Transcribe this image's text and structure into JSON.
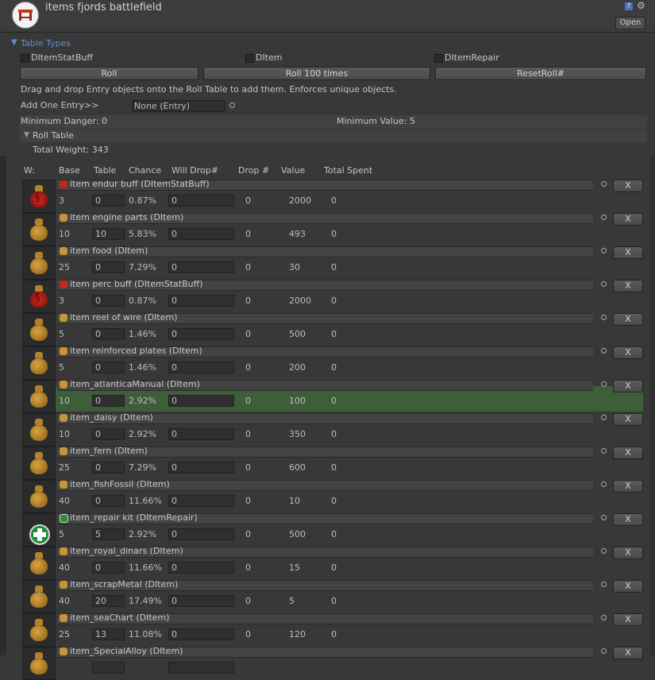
{
  "header": {
    "title": "items fjords battlefield",
    "open_label": "Open",
    "help_glyph": "?",
    "gear_glyph": "⚙"
  },
  "table_types": {
    "label": "Table Types",
    "checks": [
      "DItemStatBuff",
      "DItem",
      "DItemRepair"
    ],
    "buttons": [
      "Roll",
      "Roll 100 times",
      "ResetRoll#"
    ],
    "instructions": "Drag and drop Entry objects onto the Roll Table to add them. Enforces unique objects.",
    "add_entry_label": "Add One Entry>>",
    "add_entry_value": "None (Entry)",
    "min_danger": "Minimum Danger: 0",
    "min_value": "Minimum Value: 5",
    "roll_table_label": "Roll Table",
    "total_weight": "Total Weight: 343"
  },
  "columns": [
    "W:",
    "Base",
    "Table",
    "Chance",
    "Will Drop#",
    "Drop #",
    "Value",
    "Total Spent"
  ],
  "x_label": "X",
  "rows": [
    {
      "name": "item endur buff (DItemStatBuff)",
      "base": "3",
      "table": "0",
      "chance": "0.87%",
      "will": "0",
      "drop": "0",
      "value": "2000",
      "spent": "0",
      "icon": "buff-icon",
      "hl": false
    },
    {
      "name": "item engine parts (DItem)",
      "base": "10",
      "table": "10",
      "chance": "5.83%",
      "will": "0",
      "drop": "0",
      "value": "493",
      "spent": "0",
      "icon": "bag-icon",
      "hl": false
    },
    {
      "name": "item food (DItem)",
      "base": "25",
      "table": "0",
      "chance": "7.29%",
      "will": "0",
      "drop": "0",
      "value": "30",
      "spent": "0",
      "icon": "bag-icon",
      "hl": false
    },
    {
      "name": "item perc buff (DItemStatBuff)",
      "base": "3",
      "table": "0",
      "chance": "0.87%",
      "will": "0",
      "drop": "0",
      "value": "2000",
      "spent": "0",
      "icon": "buff-icon",
      "hl": false
    },
    {
      "name": "item reel of wire (DItem)",
      "base": "5",
      "table": "0",
      "chance": "1.46%",
      "will": "0",
      "drop": "0",
      "value": "500",
      "spent": "0",
      "icon": "bag-icon",
      "hl": false
    },
    {
      "name": "item reinforced plates (DItem)",
      "base": "5",
      "table": "0",
      "chance": "1.46%",
      "will": "0",
      "drop": "0",
      "value": "200",
      "spent": "0",
      "icon": "bag-icon",
      "hl": false
    },
    {
      "name": "item_atlanticaManual (DItem)",
      "base": "10",
      "table": "0",
      "chance": "2.92%",
      "will": "0",
      "drop": "0",
      "value": "100",
      "spent": "0",
      "icon": "bag-icon",
      "hl": true
    },
    {
      "name": "item_daisy (DItem)",
      "base": "10",
      "table": "0",
      "chance": "2.92%",
      "will": "0",
      "drop": "0",
      "value": "350",
      "spent": "0",
      "icon": "bag-icon",
      "hl": false
    },
    {
      "name": "item_fern (DItem)",
      "base": "25",
      "table": "0",
      "chance": "7.29%",
      "will": "0",
      "drop": "0",
      "value": "600",
      "spent": "0",
      "icon": "bag-icon",
      "hl": false
    },
    {
      "name": "item_fishFossil (DItem)",
      "base": "40",
      "table": "0",
      "chance": "11.66%",
      "will": "0",
      "drop": "0",
      "value": "10",
      "spent": "0",
      "icon": "bag-icon",
      "hl": false
    },
    {
      "name": "item_repair kit (DItemRepair)",
      "base": "5",
      "table": "5",
      "chance": "2.92%",
      "will": "0",
      "drop": "0",
      "value": "500",
      "spent": "0",
      "icon": "kit-icon",
      "hl": false
    },
    {
      "name": "item_royal_dinars (DItem)",
      "base": "40",
      "table": "0",
      "chance": "11.66%",
      "will": "0",
      "drop": "0",
      "value": "15",
      "spent": "0",
      "icon": "bag-icon",
      "hl": false
    },
    {
      "name": "item_scrapMetal (DItem)",
      "base": "40",
      "table": "20",
      "chance": "17.49%",
      "will": "0",
      "drop": "0",
      "value": "5",
      "spent": "0",
      "icon": "bag-icon",
      "hl": false
    },
    {
      "name": "item_seaChart (DItem)",
      "base": "25",
      "table": "13",
      "chance": "11.08%",
      "will": "0",
      "drop": "0",
      "value": "120",
      "spent": "0",
      "icon": "bag-icon",
      "hl": false
    },
    {
      "name": "item_SpecialAlloy (DItem)",
      "base": "",
      "table": "",
      "chance": "",
      "will": "",
      "drop": "",
      "value": "",
      "spent": "",
      "icon": "bag-icon",
      "hl": false
    }
  ]
}
